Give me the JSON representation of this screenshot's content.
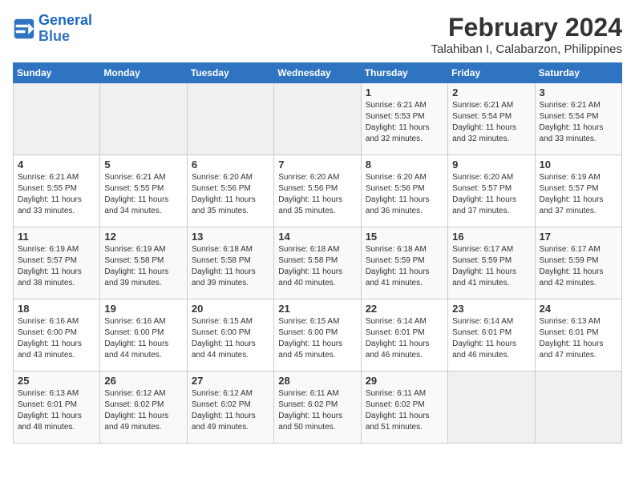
{
  "header": {
    "logo_line1": "General",
    "logo_line2": "Blue",
    "month_year": "February 2024",
    "location": "Talahiban I, Calabarzon, Philippines"
  },
  "weekdays": [
    "Sunday",
    "Monday",
    "Tuesday",
    "Wednesday",
    "Thursday",
    "Friday",
    "Saturday"
  ],
  "weeks": [
    [
      {
        "day": "",
        "info": ""
      },
      {
        "day": "",
        "info": ""
      },
      {
        "day": "",
        "info": ""
      },
      {
        "day": "",
        "info": ""
      },
      {
        "day": "1",
        "info": "Sunrise: 6:21 AM\nSunset: 5:53 PM\nDaylight: 11 hours\nand 32 minutes."
      },
      {
        "day": "2",
        "info": "Sunrise: 6:21 AM\nSunset: 5:54 PM\nDaylight: 11 hours\nand 32 minutes."
      },
      {
        "day": "3",
        "info": "Sunrise: 6:21 AM\nSunset: 5:54 PM\nDaylight: 11 hours\nand 33 minutes."
      }
    ],
    [
      {
        "day": "4",
        "info": "Sunrise: 6:21 AM\nSunset: 5:55 PM\nDaylight: 11 hours\nand 33 minutes."
      },
      {
        "day": "5",
        "info": "Sunrise: 6:21 AM\nSunset: 5:55 PM\nDaylight: 11 hours\nand 34 minutes."
      },
      {
        "day": "6",
        "info": "Sunrise: 6:20 AM\nSunset: 5:56 PM\nDaylight: 11 hours\nand 35 minutes."
      },
      {
        "day": "7",
        "info": "Sunrise: 6:20 AM\nSunset: 5:56 PM\nDaylight: 11 hours\nand 35 minutes."
      },
      {
        "day": "8",
        "info": "Sunrise: 6:20 AM\nSunset: 5:56 PM\nDaylight: 11 hours\nand 36 minutes."
      },
      {
        "day": "9",
        "info": "Sunrise: 6:20 AM\nSunset: 5:57 PM\nDaylight: 11 hours\nand 37 minutes."
      },
      {
        "day": "10",
        "info": "Sunrise: 6:19 AM\nSunset: 5:57 PM\nDaylight: 11 hours\nand 37 minutes."
      }
    ],
    [
      {
        "day": "11",
        "info": "Sunrise: 6:19 AM\nSunset: 5:57 PM\nDaylight: 11 hours\nand 38 minutes."
      },
      {
        "day": "12",
        "info": "Sunrise: 6:19 AM\nSunset: 5:58 PM\nDaylight: 11 hours\nand 39 minutes."
      },
      {
        "day": "13",
        "info": "Sunrise: 6:18 AM\nSunset: 5:58 PM\nDaylight: 11 hours\nand 39 minutes."
      },
      {
        "day": "14",
        "info": "Sunrise: 6:18 AM\nSunset: 5:58 PM\nDaylight: 11 hours\nand 40 minutes."
      },
      {
        "day": "15",
        "info": "Sunrise: 6:18 AM\nSunset: 5:59 PM\nDaylight: 11 hours\nand 41 minutes."
      },
      {
        "day": "16",
        "info": "Sunrise: 6:17 AM\nSunset: 5:59 PM\nDaylight: 11 hours\nand 41 minutes."
      },
      {
        "day": "17",
        "info": "Sunrise: 6:17 AM\nSunset: 5:59 PM\nDaylight: 11 hours\nand 42 minutes."
      }
    ],
    [
      {
        "day": "18",
        "info": "Sunrise: 6:16 AM\nSunset: 6:00 PM\nDaylight: 11 hours\nand 43 minutes."
      },
      {
        "day": "19",
        "info": "Sunrise: 6:16 AM\nSunset: 6:00 PM\nDaylight: 11 hours\nand 44 minutes."
      },
      {
        "day": "20",
        "info": "Sunrise: 6:15 AM\nSunset: 6:00 PM\nDaylight: 11 hours\nand 44 minutes."
      },
      {
        "day": "21",
        "info": "Sunrise: 6:15 AM\nSunset: 6:00 PM\nDaylight: 11 hours\nand 45 minutes."
      },
      {
        "day": "22",
        "info": "Sunrise: 6:14 AM\nSunset: 6:01 PM\nDaylight: 11 hours\nand 46 minutes."
      },
      {
        "day": "23",
        "info": "Sunrise: 6:14 AM\nSunset: 6:01 PM\nDaylight: 11 hours\nand 46 minutes."
      },
      {
        "day": "24",
        "info": "Sunrise: 6:13 AM\nSunset: 6:01 PM\nDaylight: 11 hours\nand 47 minutes."
      }
    ],
    [
      {
        "day": "25",
        "info": "Sunrise: 6:13 AM\nSunset: 6:01 PM\nDaylight: 11 hours\nand 48 minutes."
      },
      {
        "day": "26",
        "info": "Sunrise: 6:12 AM\nSunset: 6:02 PM\nDaylight: 11 hours\nand 49 minutes."
      },
      {
        "day": "27",
        "info": "Sunrise: 6:12 AM\nSunset: 6:02 PM\nDaylight: 11 hours\nand 49 minutes."
      },
      {
        "day": "28",
        "info": "Sunrise: 6:11 AM\nSunset: 6:02 PM\nDaylight: 11 hours\nand 50 minutes."
      },
      {
        "day": "29",
        "info": "Sunrise: 6:11 AM\nSunset: 6:02 PM\nDaylight: 11 hours\nand 51 minutes."
      },
      {
        "day": "",
        "info": ""
      },
      {
        "day": "",
        "info": ""
      }
    ]
  ]
}
